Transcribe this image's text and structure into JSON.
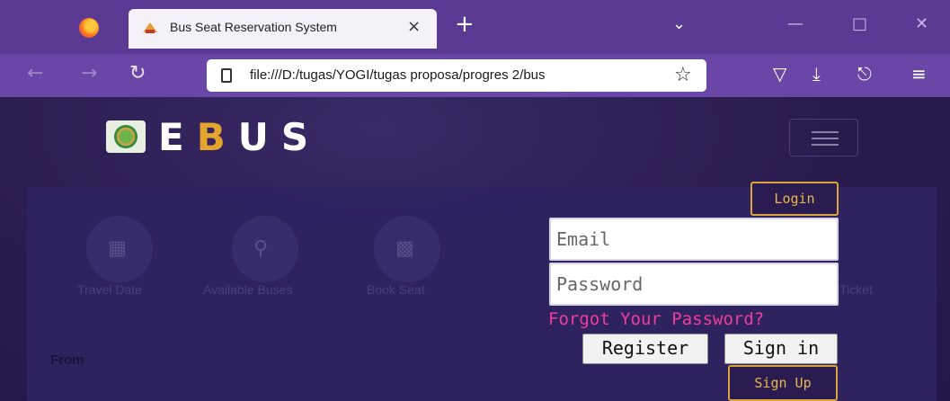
{
  "browser": {
    "tab_title": "Bus Seat Reservation System",
    "tab_close": "×",
    "new_tab": "+",
    "url": "file:///D:/tugas/YOGI/tugas proposa/progres 2/bus",
    "icons": {
      "back": "back-arrow-icon",
      "forward": "forward-arrow-icon",
      "reload": "reload-icon",
      "bookmark": "star-icon",
      "pocket": "pocket-icon",
      "downloads": "download-icon",
      "extensions": "extensions-icon",
      "menu": "hamburger-menu-icon"
    },
    "colors": {
      "tabbar": "#5a3a92",
      "navbar": "#6a46a6"
    }
  },
  "site": {
    "logo": {
      "letters": [
        "E",
        "B",
        "U",
        "S"
      ],
      "accent_color": "#e3a52e"
    },
    "steps": [
      {
        "label": "Travel Date",
        "icon": "calendar-icon"
      },
      {
        "label": "Available Buses",
        "icon": "search-icon"
      },
      {
        "label": "Book Seat",
        "icon": "bus-icon"
      },
      {
        "label": "Ticket",
        "icon": "ticket-icon"
      }
    ],
    "from_label": "From"
  },
  "login": {
    "login_button": "Login",
    "email_placeholder": "Email",
    "password_placeholder": "Password",
    "forgot": "Forgot Your Password?",
    "register_button": "Register",
    "signin_button": "Sign in",
    "signup_button": "Sign Up",
    "colors": {
      "accent": "#d9a53a",
      "link": "#f03d9c"
    }
  }
}
